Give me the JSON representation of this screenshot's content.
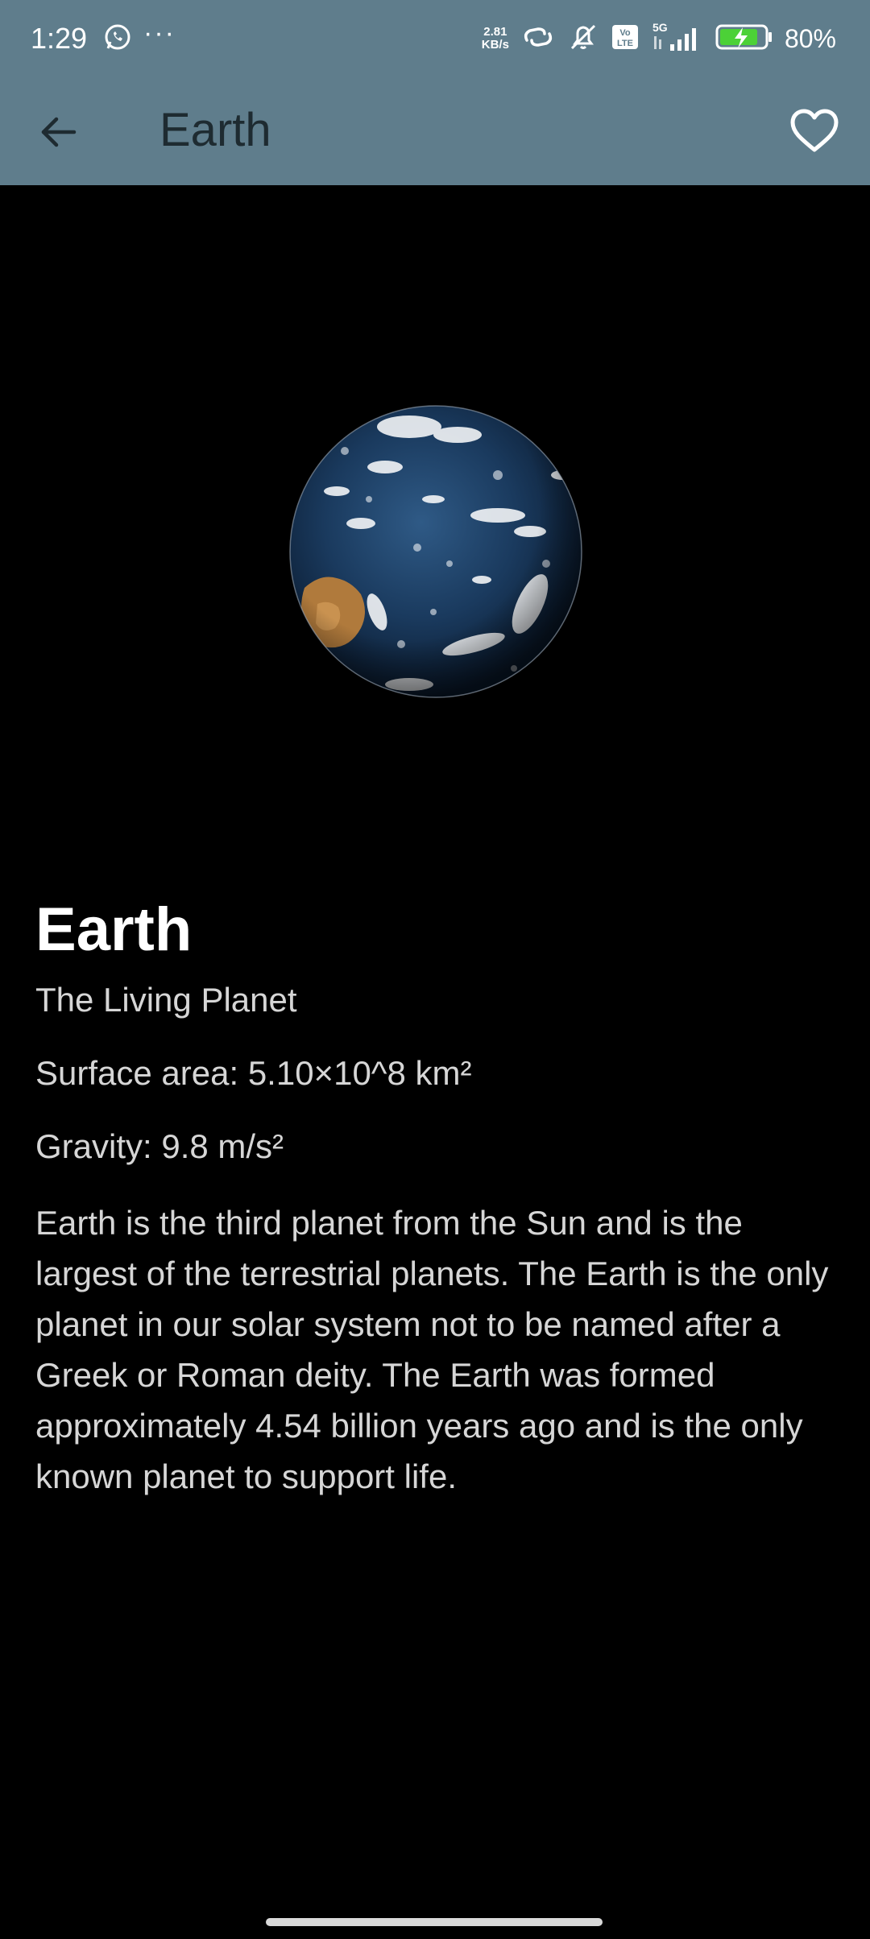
{
  "status_bar": {
    "time": "1:29",
    "net_speed_value": "2.81",
    "net_speed_unit": "KB/s",
    "network_label": "5G",
    "volte_label": "Vo LTE",
    "battery_percent": "80%",
    "icons": [
      "whatsapp-icon",
      "more-dots-icon",
      "link-icon",
      "mute-icon",
      "volte-icon",
      "signal-icon",
      "battery-charging-icon"
    ],
    "more_dots": "···"
  },
  "app_bar": {
    "title": "Earth",
    "back_icon": "arrow-back-icon",
    "favorite_icon": "heart-outline-icon"
  },
  "planet": {
    "name": "Earth",
    "tagline": "The Living Planet",
    "surface_area": "Surface area: 5.10×10^8 km²",
    "gravity": "Gravity: 9.8 m/s²",
    "description": "Earth is the third planet from the Sun and is the largest of the terrestrial planets. The Earth is the only planet in our solar system not to be named after a Greek or Roman deity. The Earth was formed approximately 4.54 billion years ago and is the only known planet to support life."
  },
  "colors": {
    "app_bar": "#5f7d8c",
    "background": "#000000",
    "title_text": "#1e2b31",
    "body_text": "#d6d6d6"
  }
}
